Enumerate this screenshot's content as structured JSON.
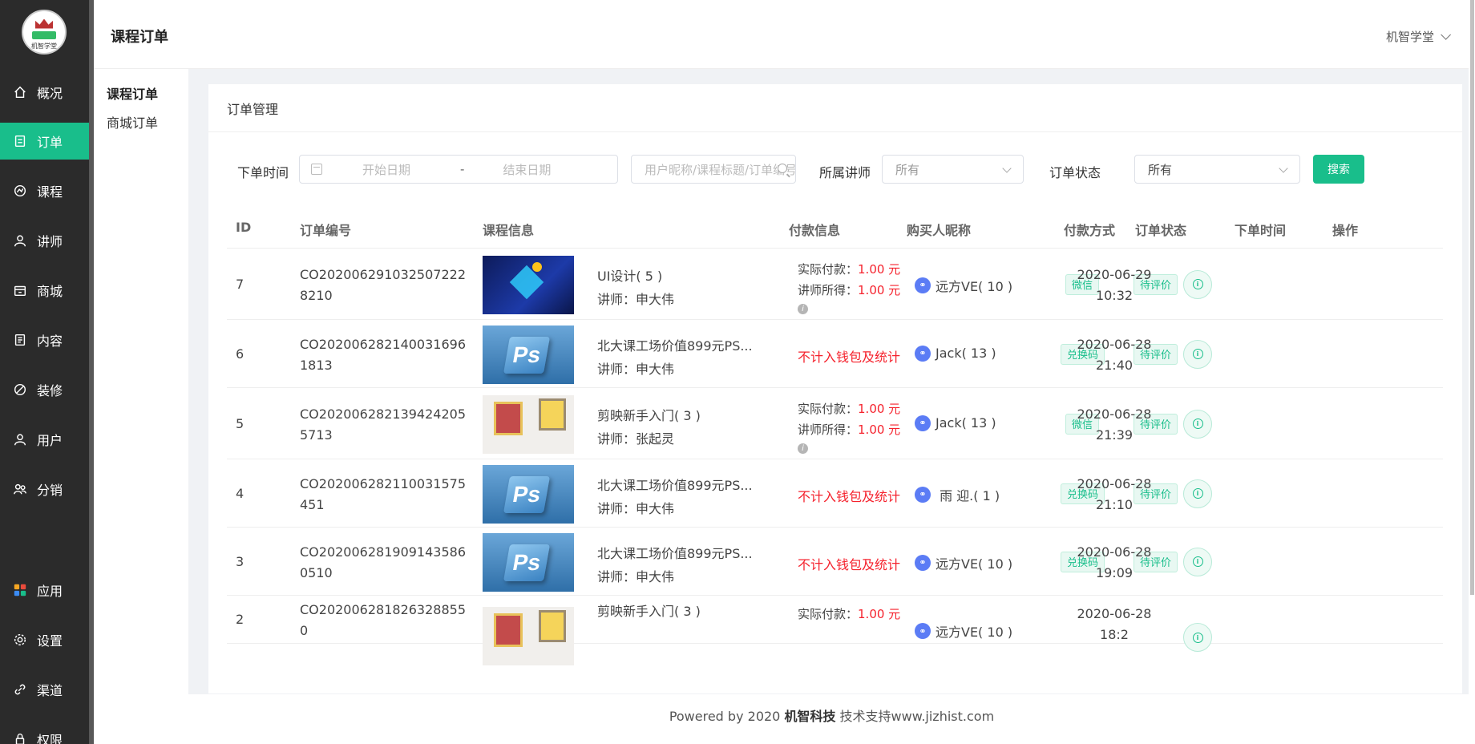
{
  "app": {
    "logo_text": "机智学堂"
  },
  "sidebar": {
    "items": [
      {
        "label": "概况",
        "icon": "home-icon"
      },
      {
        "label": "订单",
        "icon": "order-icon"
      },
      {
        "label": "课程",
        "icon": "course-icon"
      },
      {
        "label": "讲师",
        "icon": "teacher-icon"
      },
      {
        "label": "商城",
        "icon": "store-icon"
      },
      {
        "label": "内容",
        "icon": "content-icon"
      },
      {
        "label": "装修",
        "icon": "decorate-icon"
      },
      {
        "label": "用户",
        "icon": "user-icon"
      },
      {
        "label": "分销",
        "icon": "distribution-icon"
      },
      {
        "label": "应用",
        "icon": "apps-icon"
      },
      {
        "label": "设置",
        "icon": "settings-icon"
      },
      {
        "label": "渠道",
        "icon": "link-icon"
      },
      {
        "label": "权限",
        "icon": "permission-icon"
      }
    ],
    "active_index": 1,
    "accent_color": "#19be8b"
  },
  "header": {
    "title": "课程订单",
    "user_name": "机智学堂"
  },
  "subnav": {
    "items": [
      "课程订单",
      "商城订单"
    ]
  },
  "panel": {
    "title": "订单管理"
  },
  "filters": {
    "order_time_label": "下单时间",
    "start_placeholder": "开始日期",
    "range_sep": "-",
    "end_placeholder": "结束日期",
    "search_placeholder": "用户昵称/课程标题/订单编号",
    "teacher_label": "所属讲师",
    "teacher_value": "所有",
    "status_label": "订单状态",
    "status_value": "所有",
    "search_button": "搜索"
  },
  "table": {
    "columns": [
      "ID",
      "订单编号",
      "课程信息",
      "付款信息",
      "购买人昵称",
      "付款方式",
      "订单状态",
      "下单时间",
      "操作"
    ],
    "rows": [
      {
        "id": "7",
        "order_no": "CO2020062910325072228210",
        "thumb": "ui",
        "course": "UI设计( 5 )",
        "teacher": "讲师：申大伟",
        "pay_type": "full",
        "actual_label": "实际付款：",
        "actual": "1.00 元",
        "earn_label": "讲师所得：",
        "earn": "1.00 元",
        "buyer": "远方VE( 10 )",
        "method": "微信",
        "status": "待评价",
        "time": "2020-06-29 10:32"
      },
      {
        "id": "6",
        "order_no": "CO2020062821400316961813",
        "thumb": "ps",
        "course": "北大课工场价值899元PS...",
        "teacher": "讲师：申大伟",
        "pay_type": "none",
        "pay_none": "不计入钱包及统计",
        "buyer": "Jack( 13 )",
        "method": "兑换码",
        "status": "待评价",
        "time": "2020-06-28 21:40"
      },
      {
        "id": "5",
        "order_no": "CO2020062821394242055713",
        "thumb": "jy",
        "course": "剪映新手入门( 3 )",
        "teacher": "讲师：张起灵",
        "pay_type": "full",
        "actual_label": "实际付款：",
        "actual": "1.00 元",
        "earn_label": "讲师所得：",
        "earn": "1.00 元",
        "buyer": "Jack( 13 )",
        "method": "微信",
        "status": "待评价",
        "time": "2020-06-28 21:39"
      },
      {
        "id": "4",
        "order_no": "CO202006282110031575451",
        "thumb": "ps",
        "course": "北大课工场价值899元PS...",
        "teacher": "讲师：申大伟",
        "pay_type": "none",
        "pay_none": "不计入钱包及统计",
        "buyer": "󠄀 雨 迎.( 1 )",
        "method": "兑换码",
        "status": "待评价",
        "time": "2020-06-28 21:10"
      },
      {
        "id": "3",
        "order_no": "CO2020062819091435860510",
        "thumb": "ps",
        "course": "北大课工场价值899元PS...",
        "teacher": "讲师：申大伟",
        "pay_type": "none",
        "pay_none": "不计入钱包及统计",
        "buyer": "远方VE( 10 )",
        "method": "兑换码",
        "status": "待评价",
        "time": "2020-06-28 19:09"
      },
      {
        "id": "2",
        "order_no": "CO2020062818263288550",
        "thumb": "jy",
        "course": "剪映新手入门( 3 )",
        "teacher": "",
        "pay_type": "partial",
        "actual_label": "实际付款：",
        "actual": "1.00 元",
        "buyer": "远方VE( 10 )",
        "method": "",
        "status": "",
        "time": "2020-06-28 18:2"
      }
    ]
  },
  "footer": {
    "prefix": "Powered by 2020 ",
    "brand": "机智科技",
    "suffix": " 技术支持www.jizhist.com"
  }
}
